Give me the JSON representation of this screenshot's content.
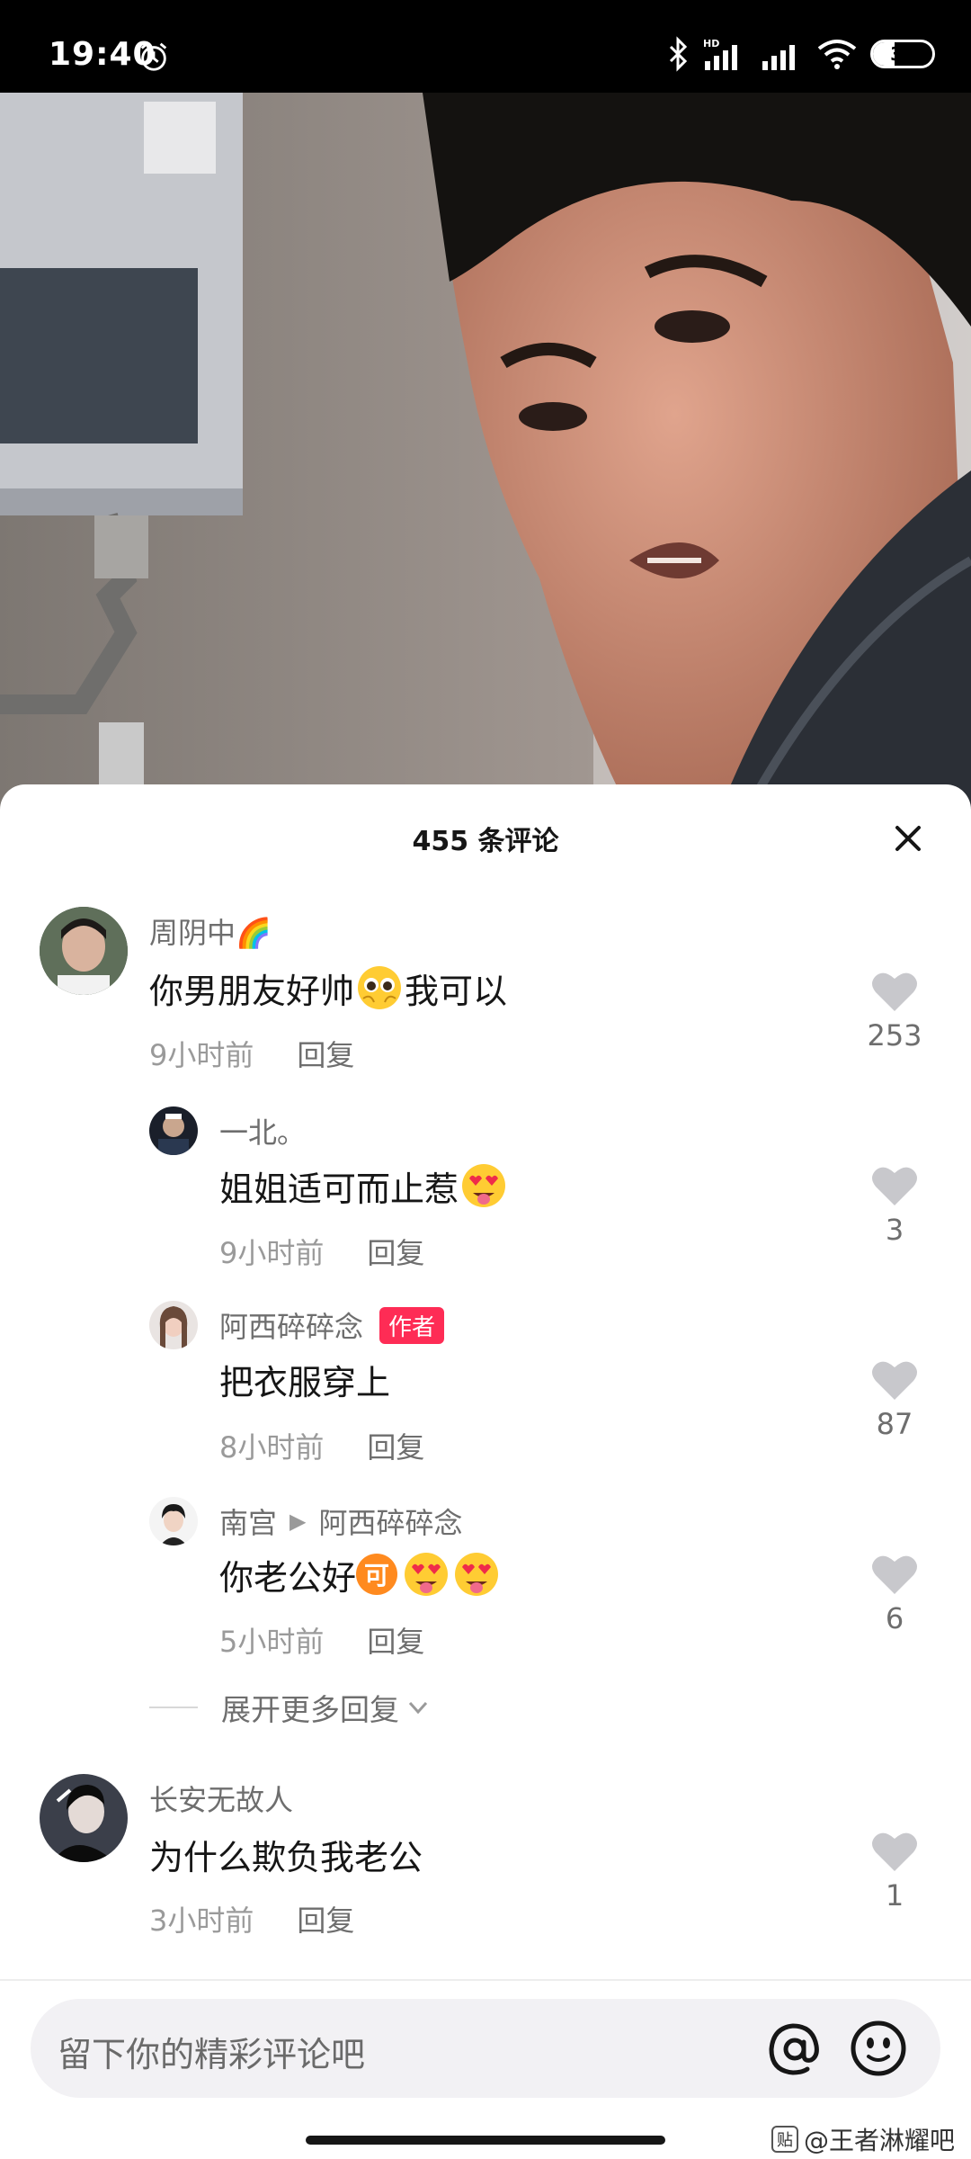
{
  "status_bar": {
    "time": "19:40",
    "network": "HD",
    "battery": "36",
    "battery_level": 0.36
  },
  "comments_panel": {
    "title": "455 条评论"
  },
  "comments": [
    {
      "username": "周阴中🌈",
      "text_before": "你男朋友好帅",
      "text_after": "我可以",
      "time": "9小时前",
      "reply": "回复",
      "likes": "253"
    },
    {
      "username": "一北。",
      "text_before": "姐姐适可而止惹",
      "time": "9小时前",
      "reply": "回复",
      "likes": "3"
    },
    {
      "username": "阿西碎碎念",
      "badge": "作者",
      "text_before": "把衣服穿上",
      "time": "8小时前",
      "reply": "回复",
      "likes": "87"
    },
    {
      "username": "南宫",
      "reply_to": "阿西碎碎念",
      "text_before": "你老公好",
      "inline_badge": "可",
      "time": "5小时前",
      "reply": "回复",
      "likes": "6"
    },
    {
      "username": "长安无故人",
      "text_before": "为什么欺负我老公",
      "time": "3小时前",
      "reply": "回复",
      "likes": "1"
    }
  ],
  "expand_replies": "展开更多回复",
  "input": {
    "placeholder": "留下你的精彩评论吧"
  },
  "watermark": {
    "icon_text": "贴",
    "text": "@王者淋耀吧"
  },
  "colors": {
    "accent_badge": "#fe2c55",
    "text_primary": "#161616",
    "text_secondary": "#6e6e6e"
  }
}
